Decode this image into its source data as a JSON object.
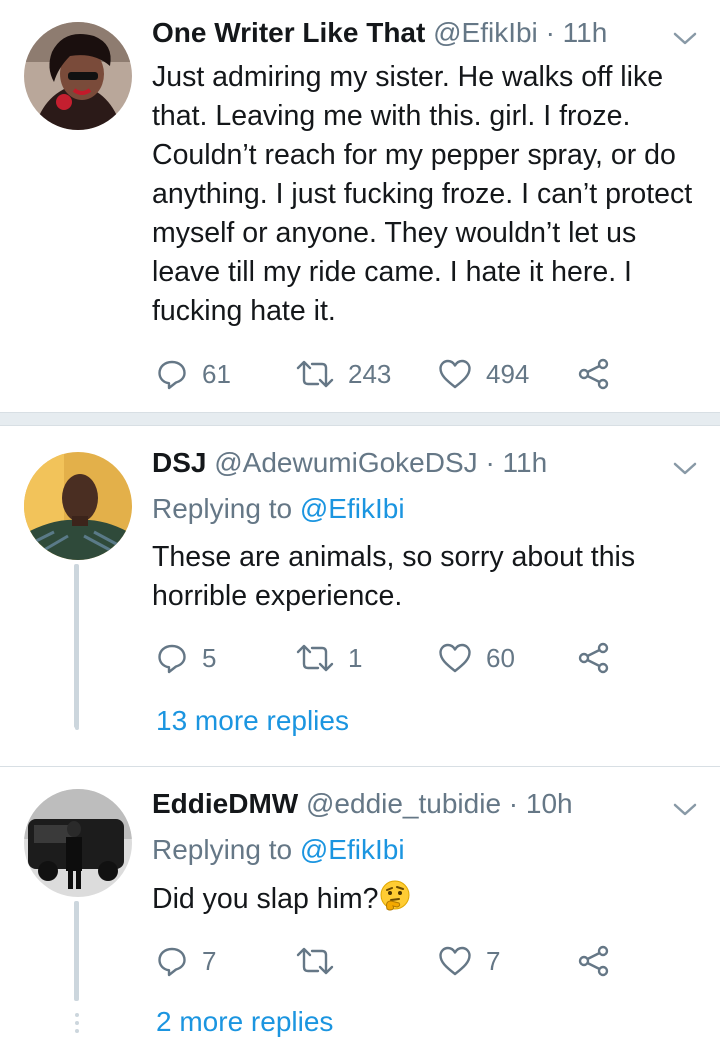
{
  "tweets": [
    {
      "name": "One Writer Like That",
      "handle": "@EfikIbi",
      "dot": "·",
      "time": "11h",
      "text": "Just admiring my sister. He walks off like that. Leaving me with this. girl. I froze. Couldn’t reach for my pepper spray, or do anything. I just fucking froze. I can’t protect myself or anyone. They wouldn’t let us leave till my ride came. I hate it here. I fucking hate it.",
      "replies": "61",
      "retweets": "243",
      "likes": "494"
    },
    {
      "name": "DSJ",
      "handle": "@AdewumiGokeDSJ",
      "dot": "·",
      "time": "11h",
      "replying_prefix": "Replying to",
      "replying_to": "@EfikIbi",
      "text": "These are animals, so sorry about this horrible experience.",
      "replies": "5",
      "retweets": "1",
      "likes": "60",
      "more_replies": "13 more replies"
    },
    {
      "name": "EddieDMW",
      "handle": "@eddie_tubidie",
      "dot": "·",
      "time": "10h",
      "replying_prefix": "Replying to",
      "replying_to": "@EfikIbi",
      "text": "Did you slap him?",
      "emoji": "thinking-face",
      "replies": "7",
      "retweets": "",
      "likes": "7",
      "more_replies": "2 more replies"
    }
  ],
  "colors": {
    "text": "#14171a",
    "secondary": "#657786",
    "link": "#1b95e0",
    "thread_line": "#ccd6dd",
    "divider": "#e6ecf0"
  },
  "icons": [
    "reply-icon",
    "retweet-icon",
    "like-icon",
    "share-icon",
    "chevron-down-icon"
  ]
}
